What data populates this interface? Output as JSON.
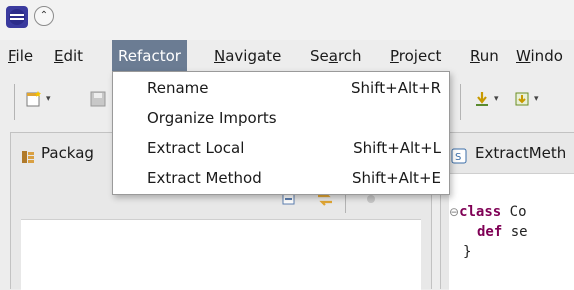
{
  "menubar": {
    "items": [
      {
        "first": "F",
        "rest": "ile"
      },
      {
        "first": "E",
        "rest": "dit"
      },
      {
        "first": "",
        "rest": "Refactor"
      },
      {
        "first": "N",
        "rest": "avigate"
      },
      {
        "first": "Se",
        "u": "a",
        "rest2": "rch"
      },
      {
        "first": "P",
        "rest": "roject"
      },
      {
        "first": "R",
        "rest": "un"
      },
      {
        "first": "W",
        "rest": "indo"
      }
    ]
  },
  "refactor_menu": {
    "items": [
      {
        "label": "Rename",
        "shortcut": "Shift+Alt+R"
      },
      {
        "label": "Organize Imports",
        "shortcut": ""
      },
      {
        "label": "Extract Local",
        "shortcut": "Shift+Alt+L"
      },
      {
        "label": "Extract Method",
        "shortcut": "Shift+Alt+E"
      }
    ]
  },
  "package_view": {
    "tab_label": "Packag"
  },
  "editor": {
    "tab_label": "ExtractMeth",
    "code": {
      "line1_kw": "class",
      "line1_rest": " Co",
      "line2_kw": "def",
      "line2_rest": " se",
      "line3": "}"
    }
  },
  "colors": {
    "menu_active_bg": "#6b7c93",
    "keyword": "#7f0055"
  }
}
